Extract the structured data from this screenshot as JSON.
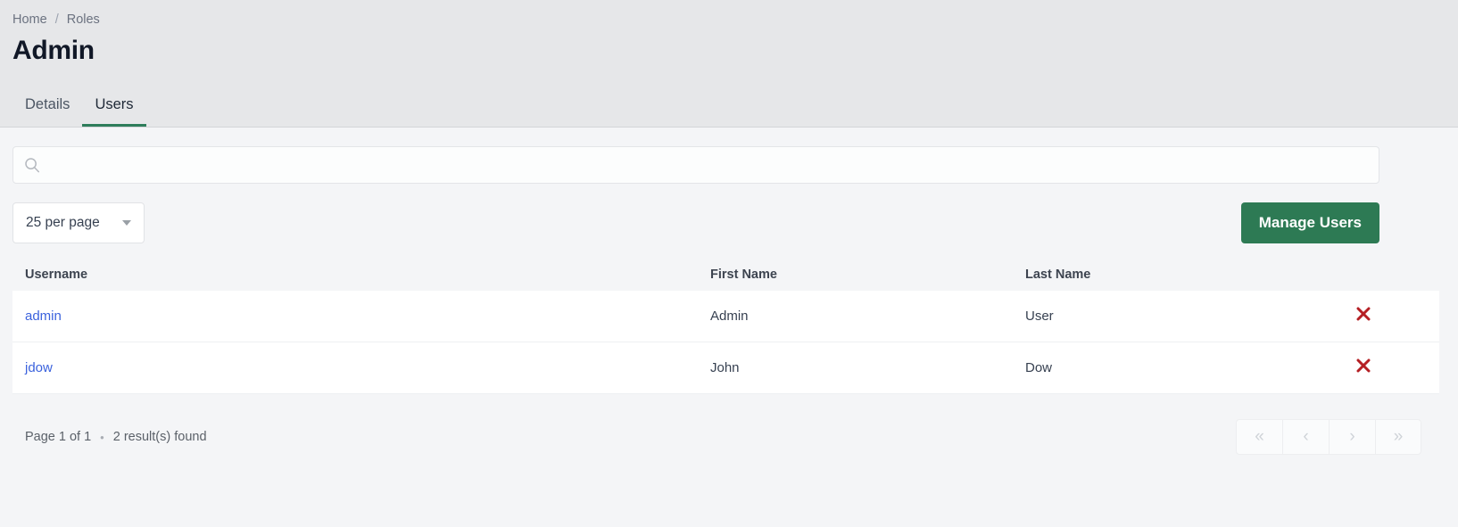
{
  "breadcrumb": {
    "items": [
      {
        "label": "Home"
      },
      {
        "label": "Roles"
      }
    ],
    "separator": "/"
  },
  "page_title": "Admin",
  "tabs": [
    {
      "label": "Details",
      "active": false
    },
    {
      "label": "Users",
      "active": true
    }
  ],
  "search": {
    "value": "",
    "placeholder": "",
    "icon": "search-icon"
  },
  "toolbar": {
    "per_page_label": "25 per page",
    "per_page_options": [
      "25 per page"
    ],
    "manage_users_label": "Manage Users"
  },
  "table": {
    "columns": [
      "Username",
      "First Name",
      "Last Name"
    ],
    "rows": [
      {
        "username": "admin",
        "first_name": "Admin",
        "last_name": "User",
        "delete_icon": "close-x-icon"
      },
      {
        "username": "jdow",
        "first_name": "John",
        "last_name": "Dow",
        "delete_icon": "close-x-icon"
      }
    ]
  },
  "footer": {
    "page_info": "Page 1 of 1",
    "separator": "•",
    "result_info": "2 result(s) found",
    "pagination": [
      {
        "label": "«",
        "name": "first-page"
      },
      {
        "label": "‹",
        "name": "prev-page"
      },
      {
        "label": "›",
        "name": "next-page"
      },
      {
        "label": "»",
        "name": "last-page"
      }
    ]
  },
  "colors": {
    "accent_green": "#2d7a54",
    "link_blue": "#3b62dd",
    "delete_red": "#b51f24",
    "header_bg": "#e6e7e9",
    "body_bg": "#f4f5f7"
  }
}
